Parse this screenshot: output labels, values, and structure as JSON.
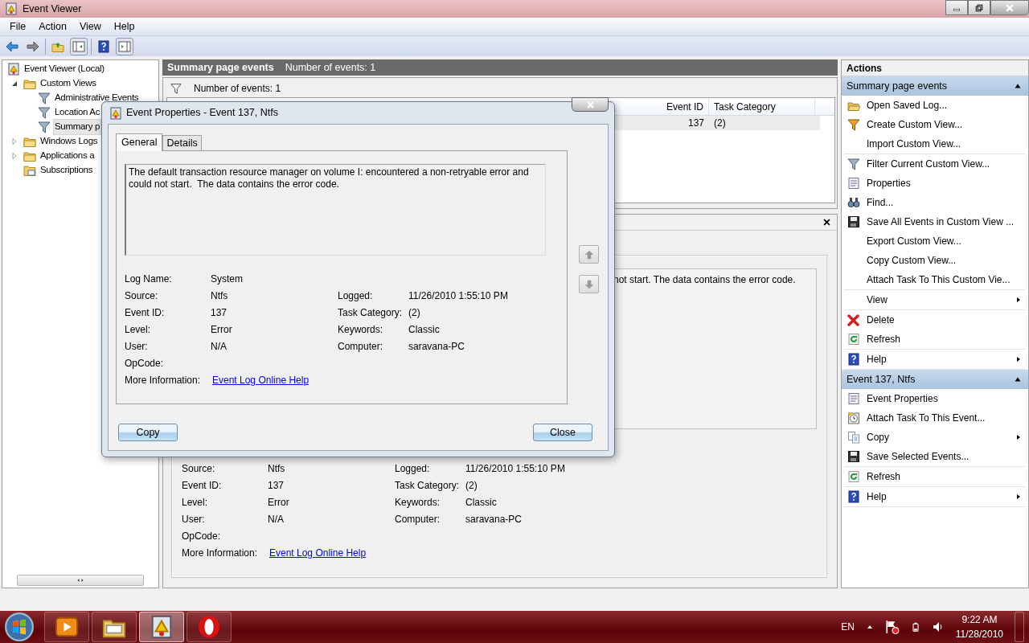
{
  "window": {
    "title": "Event Viewer"
  },
  "menu": [
    "File",
    "Action",
    "View",
    "Help"
  ],
  "tree": [
    {
      "label": "Event Viewer (Local)",
      "kind": "viewer",
      "selected": false,
      "children": [
        {
          "label": "Custom Views",
          "kind": "folder",
          "expanded": true,
          "selected": false,
          "children": [
            {
              "label": "Administrative Events",
              "kind": "filter",
              "selected": false
            },
            {
              "label": "Location Ac",
              "kind": "filter",
              "selected": false
            },
            {
              "label": "Summary p",
              "kind": "filter",
              "selected": true
            }
          ]
        },
        {
          "label": "Windows Logs",
          "kind": "folder",
          "expanded": false,
          "selected": false
        },
        {
          "label": "Applications a",
          "kind": "folder",
          "expanded": false,
          "selected": false
        },
        {
          "label": "Subscriptions",
          "kind": "subscriptions",
          "selected": false
        }
      ]
    }
  ],
  "summary": {
    "title": "Summary page events",
    "count": "Number of events: 1",
    "filter_text": "Number of events: 1",
    "columns": [
      "Event ID",
      "Task Category"
    ],
    "rows": [
      {
        "cells": [
          "137",
          "(2)"
        ],
        "selected": true
      }
    ]
  },
  "preview": {
    "description": "not start.  The data contains the error code.",
    "rows": [
      [
        {
          "label": "Source:",
          "value": "Ntfs"
        },
        {
          "label": "Logged:",
          "value": "11/26/2010 1:55:10 PM"
        }
      ],
      [
        {
          "label": "Event ID:",
          "value": "137"
        },
        {
          "label": "Task Category:",
          "value": "(2)"
        }
      ],
      [
        {
          "label": "Level:",
          "value": "Error"
        },
        {
          "label": "Keywords:",
          "value": "Classic"
        }
      ],
      [
        {
          "label": "User:",
          "value": "N/A"
        },
        {
          "label": "Computer:",
          "value": "saravana-PC"
        }
      ],
      [
        {
          "label": "OpCode:"
        }
      ]
    ],
    "more_info": {
      "label": "More Information:",
      "link": "Event Log Online Help"
    }
  },
  "actions": {
    "title": "Actions",
    "sections": [
      {
        "title": "Summary page events",
        "expanded": true,
        "groups": [
          [
            {
              "label": "Open Saved Log...",
              "kind": "open",
              "submenu": false
            },
            {
              "label": "Create Custom View...",
              "kind": "newfilter",
              "submenu": false
            },
            {
              "label": "Import Custom View...",
              "submenu": false
            }
          ],
          [
            {
              "label": "Filter Current Custom View...",
              "kind": "filter",
              "submenu": false
            },
            {
              "label": "Properties",
              "kind": "properties",
              "submenu": false
            },
            {
              "label": "Find...",
              "kind": "find",
              "submenu": false
            },
            {
              "label": "Save All Events in Custom View ...",
              "kind": "save",
              "submenu": false
            },
            {
              "label": "Export Custom View...",
              "submenu": false
            },
            {
              "label": "Copy Custom View...",
              "submenu": false
            },
            {
              "label": "Attach Task To This Custom Vie...",
              "submenu": false
            }
          ],
          [
            {
              "label": "View",
              "submenu": true
            }
          ],
          [
            {
              "label": "Delete",
              "kind": "delete",
              "submenu": false
            },
            {
              "label": "Refresh",
              "kind": "refresh",
              "submenu": false
            }
          ],
          [
            {
              "label": "Help",
              "kind": "help",
              "submenu": true
            }
          ]
        ]
      },
      {
        "title": "Event 137, Ntfs",
        "expanded": true,
        "groups": [
          [
            {
              "label": "Event Properties",
              "kind": "properties",
              "submenu": false
            },
            {
              "label": "Attach Task To This Event...",
              "kind": "task",
              "submenu": false
            },
            {
              "label": "Copy",
              "kind": "copy",
              "submenu": true
            },
            {
              "label": "Save Selected Events...",
              "kind": "save",
              "submenu": false
            }
          ],
          [
            {
              "label": "Refresh",
              "kind": "refresh",
              "submenu": false
            }
          ],
          [
            {
              "label": "Help",
              "kind": "help",
              "submenu": true
            }
          ]
        ]
      }
    ]
  },
  "dialog": {
    "title": "Event Properties - Event 137, Ntfs",
    "tabs": [
      {
        "label": "General",
        "selected": true
      },
      {
        "label": "Details",
        "selected": false
      }
    ],
    "description": "The default transaction resource manager on volume I: encountered a non-retryable error and could not start.  The data contains the error code.",
    "rows": [
      [
        {
          "label": "Log Name:",
          "value": "System"
        }
      ],
      [
        {
          "label": "Source:",
          "value": "Ntfs"
        },
        {
          "label": "Logged:",
          "value": "11/26/2010 1:55:10 PM"
        }
      ],
      [
        {
          "label": "Event ID:",
          "value": "137"
        },
        {
          "label": "Task Category:",
          "value": "(2)"
        }
      ],
      [
        {
          "label": "Level:",
          "value": "Error"
        },
        {
          "label": "Keywords:",
          "value": "Classic"
        }
      ],
      [
        {
          "label": "User:",
          "value": "N/A"
        },
        {
          "label": "Computer:",
          "value": "saravana-PC"
        }
      ],
      [
        {
          "label": "OpCode:"
        }
      ]
    ],
    "more_info": {
      "label": "More Information:",
      "link": "Event Log Online Help"
    },
    "buttons": [
      "Copy",
      "Close"
    ]
  },
  "taskbar": {
    "apps": [
      {
        "kind": "media",
        "selected": false
      },
      {
        "kind": "explorer",
        "selected": false
      },
      {
        "kind": "eventviewer",
        "selected": true
      },
      {
        "kind": "opera",
        "selected": false
      }
    ],
    "language": "EN",
    "time": "9:22 AM",
    "date": "11/28/2010"
  }
}
